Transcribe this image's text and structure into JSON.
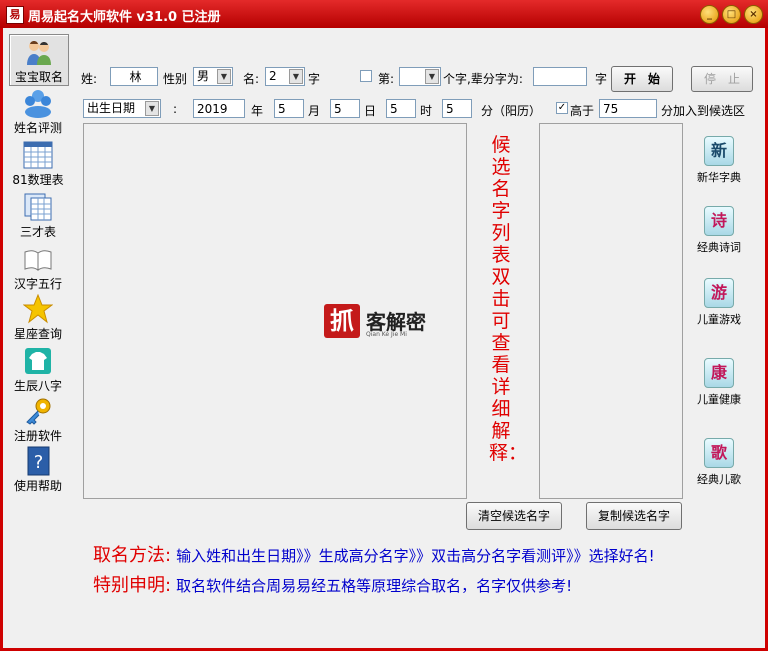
{
  "window": {
    "title": "周易起名大师软件 v31.0  已注册",
    "app_icon": "易",
    "controls": {
      "minimize": "_",
      "maximize": "□",
      "close": "×"
    }
  },
  "sidebar": {
    "items": [
      {
        "label": "宝宝取名",
        "icon": "baby-icon"
      },
      {
        "label": "姓名评测",
        "icon": "people-icon"
      },
      {
        "label": "81数理表",
        "icon": "table-icon"
      },
      {
        "label": "三才表",
        "icon": "sheets-icon"
      },
      {
        "label": "汉字五行",
        "icon": "book-icon"
      },
      {
        "label": "星座查询",
        "icon": "star-icon"
      },
      {
        "label": "生辰八字",
        "icon": "shirt-icon"
      },
      {
        "label": "注册软件",
        "icon": "key-icon"
      },
      {
        "label": "使用帮助",
        "icon": "help-icon"
      }
    ]
  },
  "form": {
    "surname_label": "姓:",
    "surname_value": "林",
    "gender_label": "性别",
    "gender_value": "男",
    "name_label": "名:",
    "name_count": "2",
    "name_unit": "字",
    "position_label": "第:",
    "position_value": "",
    "position_unit": "个字,辈分字为:",
    "generation_value": "",
    "generation_unit": "字",
    "start_button": "开　始",
    "stop_button": "停　止",
    "date_type": "出生日期",
    "colon": ":",
    "year_value": "2019",
    "year_label": "年",
    "month_value": "5",
    "month_label": "月",
    "day_value": "5",
    "day_label": "日",
    "hour_value": "5",
    "hour_label": "时",
    "minute_value": "5",
    "minute_label": "分（阳历）",
    "above_label": "高于",
    "above_checked": "✓",
    "score_value": "75",
    "score_suffix": "分加入到候选区"
  },
  "watermark": {
    "logo_char": "抓",
    "brand": "客解密",
    "sub": "Qian Ke Jie Mi"
  },
  "candidate_hint": "候选名字列表双击可查看详细解释：",
  "right_tools": [
    {
      "label": "新华字典",
      "icon_char": "新"
    },
    {
      "label": "经典诗词",
      "icon_char": "诗"
    },
    {
      "label": "儿童游戏",
      "icon_char": "游"
    },
    {
      "label": "儿童健康",
      "icon_char": "康"
    },
    {
      "label": "经典儿歌",
      "icon_char": "歌"
    }
  ],
  "actions": {
    "clear": "清空候选名字",
    "copy": "复制候选名字"
  },
  "footer": {
    "method_label": "取名方法:",
    "method_text": "输入姓和出生日期》》生成高分名字》》双击高分名字看测评》》选择好名!",
    "notice_label": "特别申明:",
    "notice_text": "取名软件结合周易易经五格等原理综合取名，名字仅供参考!"
  },
  "colors": {
    "title_red": "#ce0000",
    "hint_red": "#e00000",
    "footer_blue": "#0000cc"
  }
}
